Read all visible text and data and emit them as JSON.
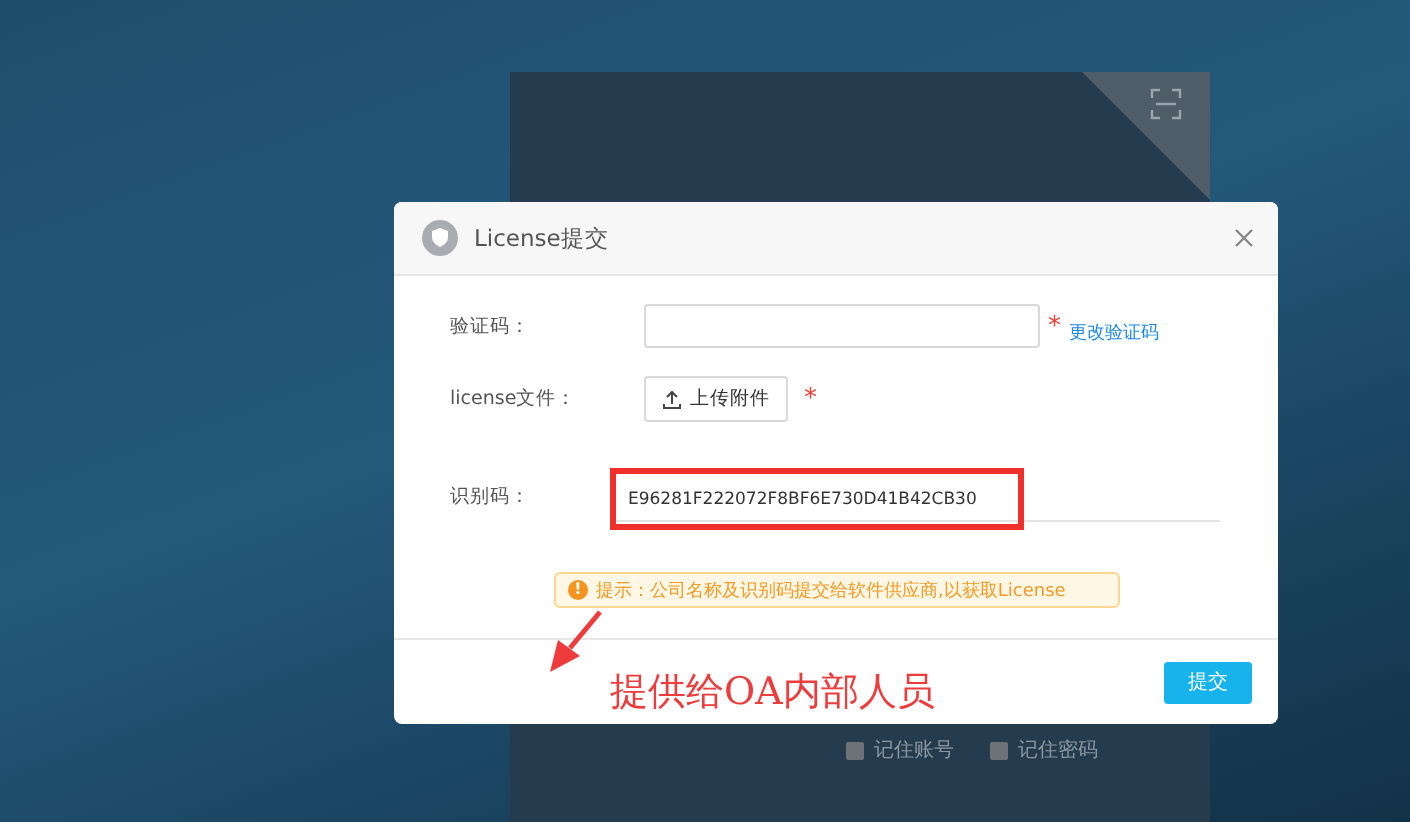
{
  "login_panel": {
    "options": [
      {
        "label": "记住账号",
        "checked": false
      },
      {
        "label": "记住密码",
        "checked": false
      }
    ]
  },
  "dialog": {
    "title": "License提交",
    "required_mark": "*",
    "fields": [
      {
        "kind": "input",
        "label": "验证码：",
        "required": true,
        "link": "更改验证码"
      },
      {
        "kind": "upload",
        "label": "license文件：",
        "button": "上传附件",
        "required": true
      },
      {
        "kind": "readonly",
        "label": "识别码：",
        "value": "E96281F222072F8BF6E730D41B42CB30"
      }
    ],
    "alert": {
      "icon": "!",
      "text": "提示：公司名称及识别码提交给软件供应商,以获取License"
    },
    "submit": "提交"
  },
  "annotation": {
    "text": "提供给OA内部人员"
  }
}
